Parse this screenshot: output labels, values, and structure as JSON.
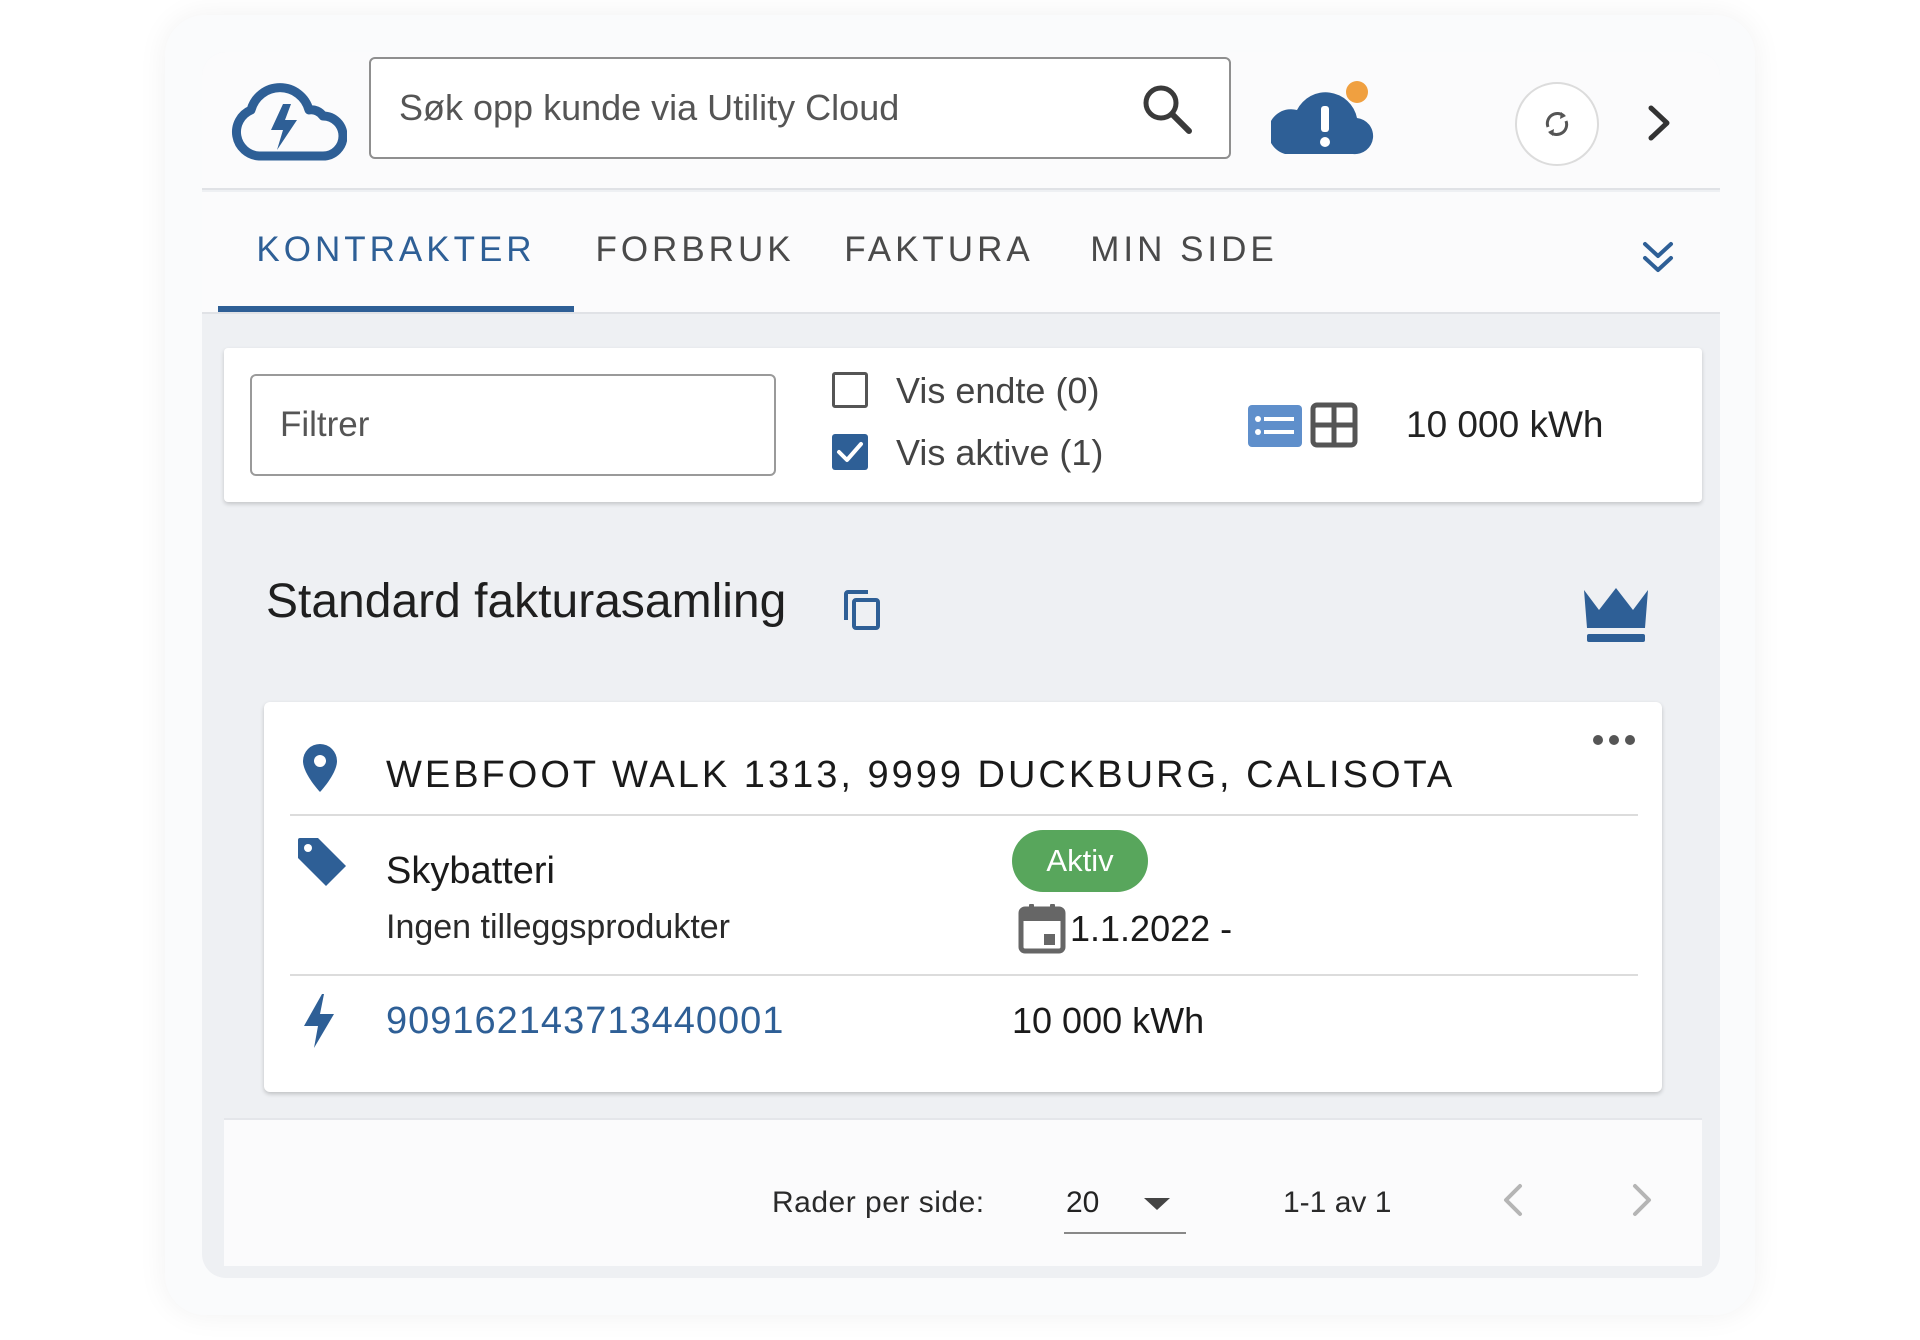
{
  "header": {
    "search_placeholder": "Søk opp kunde via Utility Cloud",
    "icons": [
      "cloud-bolt-logo-icon",
      "search-icon",
      "cloud-alert-icon",
      "refresh-icon",
      "chevron-right-icon"
    ],
    "notification_dot_color": "#f0a040"
  },
  "tabs": [
    {
      "label": "KONTRAKTER",
      "active": true
    },
    {
      "label": "FORBRUK",
      "active": false
    },
    {
      "label": "FAKTURA",
      "active": false
    },
    {
      "label": "MIN SIDE",
      "active": false
    }
  ],
  "filter": {
    "placeholder": "Filtrer",
    "show_ended": {
      "label": "Vis endte (0)",
      "checked": false
    },
    "show_active": {
      "label": "Vis aktive (1)",
      "checked": true
    },
    "total_usage": "10 000 kWh"
  },
  "group": {
    "title": "Standard fakturasamling"
  },
  "contract": {
    "address": "WEBFOOT WALK 1313, 9999 DUCKBURG, CALISOTA",
    "product": "Skybatteri",
    "addons": "Ingen tilleggsprodukter",
    "status": "Aktiv",
    "start_date": "1.1.2022 -",
    "meter_id": "909162143713440001",
    "usage": "10 000 kWh"
  },
  "pagination": {
    "rows_label": "Rader per side:",
    "rows_value": "20",
    "range": "1-1 av 1"
  },
  "colors": {
    "primary": "#2e5f96",
    "active_badge": "#58a65c",
    "background": "#eef0f3"
  }
}
